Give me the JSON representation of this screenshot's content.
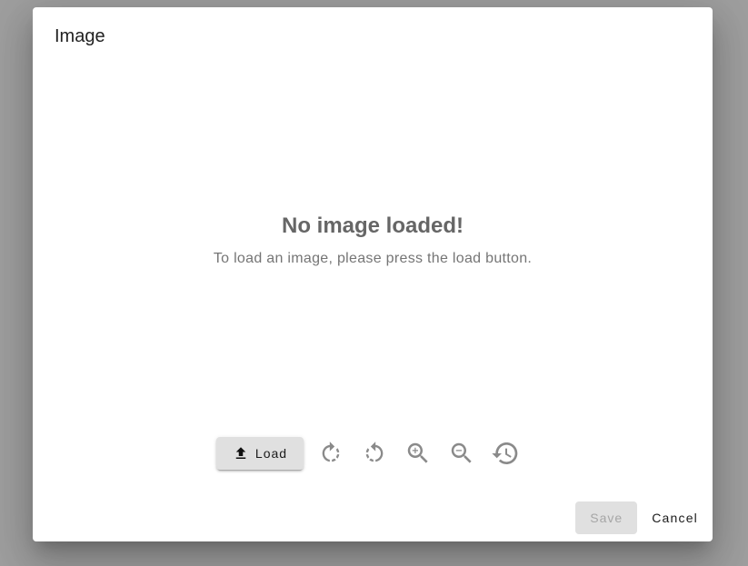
{
  "dialog": {
    "title": "Image",
    "empty_state": {
      "heading": "No image loaded!",
      "message": "To load an image, please press the load button."
    },
    "toolbar": {
      "load_label": "Load",
      "icons": [
        "upload-icon",
        "rotate-right-icon",
        "rotate-left-icon",
        "zoom-in-icon",
        "zoom-out-icon",
        "reset-history-icon"
      ]
    },
    "actions": {
      "save_label": "Save",
      "cancel_label": "Cancel"
    }
  },
  "colors": {
    "backdrop": "#9e9e9e",
    "dialog_bg": "#ffffff",
    "button_bg": "#e0e0e0",
    "icon_gray": "#8a8a8a",
    "heading_gray": "#666666"
  }
}
